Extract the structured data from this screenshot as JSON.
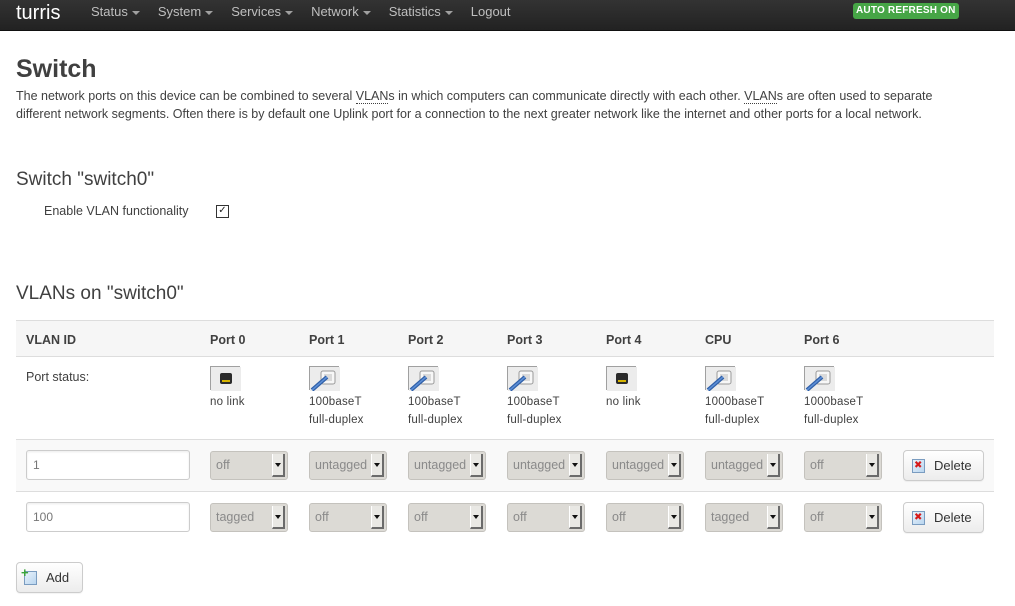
{
  "topbar": {
    "brand": "turris",
    "nav": [
      {
        "label": "Status",
        "dropdown": true
      },
      {
        "label": "System",
        "dropdown": true
      },
      {
        "label": "Services",
        "dropdown": true
      },
      {
        "label": "Network",
        "dropdown": true
      },
      {
        "label": "Statistics",
        "dropdown": true
      },
      {
        "label": "Logout",
        "dropdown": false
      }
    ],
    "auto_refresh": "AUTO REFRESH ON",
    "auto_refresh_color": "#46a546"
  },
  "page": {
    "title": "Switch",
    "intro_parts": {
      "p1": "The network ports on this device can be combined to several ",
      "abbr1": "VLAN",
      "p2": "s in which computers can communicate directly with each other. ",
      "abbr2": "VLAN",
      "p3": "s are often used to separate different network segments. Often there is by default one Uplink port for a connection to the next greater network like the internet and other ports for a local network."
    }
  },
  "switch": {
    "heading": "Switch \"switch0\"",
    "enable_vlan_label": "Enable VLAN functionality",
    "enable_vlan_checked": true,
    "checkbox_glyph": "✓"
  },
  "vlans": {
    "heading": "VLANs on \"switch0\"",
    "columns": [
      "VLAN ID",
      "Port 0",
      "Port 1",
      "Port 2",
      "Port 3",
      "Port 4",
      "CPU",
      "Port 6"
    ],
    "port_status_label": "Port status:",
    "port_status": [
      {
        "icon": "port-disconnected-icon",
        "line1": "no link",
        "line2": ""
      },
      {
        "icon": "port-connected-icon",
        "line1": "100baseT",
        "line2": "full-duplex"
      },
      {
        "icon": "port-connected-icon",
        "line1": "100baseT",
        "line2": "full-duplex"
      },
      {
        "icon": "port-connected-icon",
        "line1": "100baseT",
        "line2": "full-duplex"
      },
      {
        "icon": "port-disconnected-icon",
        "line1": "no link",
        "line2": ""
      },
      {
        "icon": "port-connected-icon",
        "line1": "1000baseT",
        "line2": "full-duplex"
      },
      {
        "icon": "port-connected-icon",
        "line1": "1000baseT",
        "line2": "full-duplex"
      }
    ],
    "rows": [
      {
        "vlan_id": "1",
        "ports": [
          "off",
          "untagged",
          "untagged",
          "untagged",
          "untagged",
          "untagged",
          "off"
        ],
        "delete_label": "Delete"
      },
      {
        "vlan_id": "100",
        "ports": [
          "tagged",
          "off",
          "off",
          "off",
          "off",
          "tagged",
          "off"
        ],
        "delete_label": "Delete"
      }
    ],
    "add_label": "Add"
  }
}
